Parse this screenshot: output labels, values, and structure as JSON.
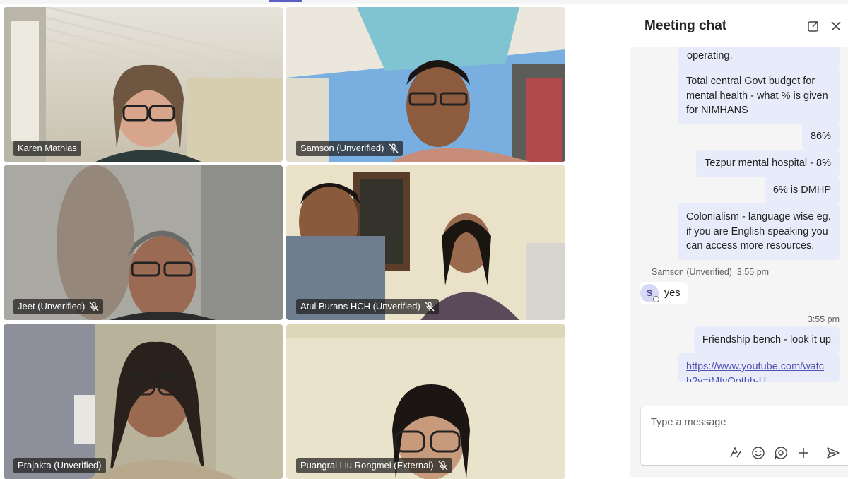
{
  "participants": [
    {
      "name": "Karen Mathias",
      "muted": false
    },
    {
      "name": "Samson (Unverified)",
      "muted": true
    },
    {
      "name": "Jeet (Unverified)",
      "muted": true
    },
    {
      "name": "Atul Burans HCH (Unverified)",
      "muted": true
    },
    {
      "name": "Prajakta (Unverified)",
      "muted": false
    },
    {
      "name": "Puangrai Liu Rongmei (External)",
      "muted": true
    }
  ],
  "chat": {
    "title": "Meeting chat",
    "messages_out_1": [
      "operating.",
      "Total central Govt budget for mental health - what % is given for NIMHANS",
      "86%",
      "Tezpur mental hospital - 8%",
      "6% is DMHP",
      "Colonialism - language wise eg. if you are English speaking you can access more resources."
    ],
    "incoming": {
      "sender": "Samson (Unverified)",
      "time": "3:55 pm",
      "initial": "S",
      "text": "yes"
    },
    "out_time": "3:55 pm",
    "messages_out_2": [
      "Friendship bench - look it up"
    ],
    "link": "https://www.youtube.com/watch?v=iMtvQothh-U",
    "composer_placeholder": "Type a message"
  },
  "colors": {
    "accent": "#5b5fc7",
    "bubble_out": "#e8ebfa",
    "panel_bg": "#f5f5f5"
  }
}
